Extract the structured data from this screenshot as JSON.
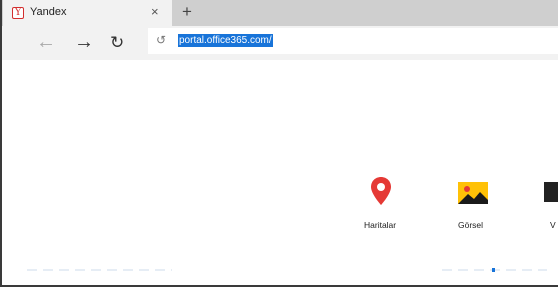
{
  "browser": {
    "tab": {
      "title": "Yandex",
      "favicon_letter": "Y",
      "close_symbol": "×"
    },
    "new_tab_symbol": "+",
    "nav": {
      "back_symbol": "←",
      "forward_symbol": "→",
      "refresh_symbol": "↻"
    },
    "address_bar": {
      "history_symbol": "↺",
      "url": "portal.office365.com/",
      "url_selected": true
    }
  },
  "tiles": [
    {
      "label": "Haritalar",
      "icon": "map-pin-icon",
      "color": "#e53935"
    },
    {
      "label": "Görsel",
      "icon": "image-icon",
      "color": "#ffc107"
    },
    {
      "label": "V",
      "icon": "video-icon",
      "color": "#222222"
    }
  ],
  "colors": {
    "url_highlight": "#1874d9",
    "tab_strip": "#cfcfcf",
    "tab_active": "#f2f2f2"
  }
}
